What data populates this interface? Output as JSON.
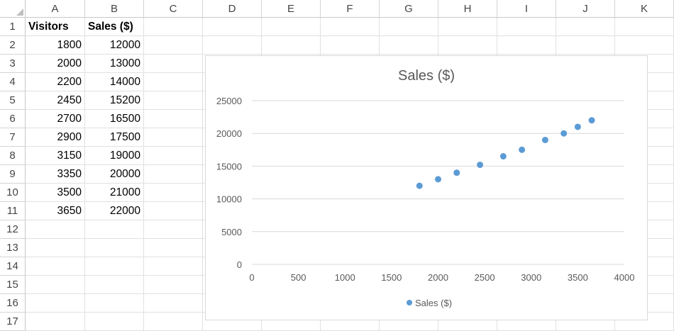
{
  "sheet": {
    "columns": [
      "A",
      "B",
      "C",
      "D",
      "E",
      "F",
      "G",
      "H",
      "I",
      "J",
      "K"
    ],
    "rows": [
      "1",
      "2",
      "3",
      "4",
      "5",
      "6",
      "7",
      "8",
      "9",
      "10",
      "11",
      "12",
      "13",
      "14",
      "15",
      "16",
      "17"
    ],
    "headers": [
      "Visitors",
      "Sales ($)"
    ],
    "data": [
      [
        "1800",
        "12000"
      ],
      [
        "2000",
        "13000"
      ],
      [
        "2200",
        "14000"
      ],
      [
        "2450",
        "15200"
      ],
      [
        "2700",
        "16500"
      ],
      [
        "2900",
        "17500"
      ],
      [
        "3150",
        "19000"
      ],
      [
        "3350",
        "20000"
      ],
      [
        "3500",
        "21000"
      ],
      [
        "3650",
        "22000"
      ]
    ]
  },
  "colors": {
    "marker": "#5b9bd5",
    "grid": "#d9d9d9",
    "text": "#595959"
  },
  "chart_data": {
    "type": "scatter",
    "title": "Sales ($)",
    "xlabel": "",
    "ylabel": "",
    "xlim": [
      0,
      4000
    ],
    "ylim": [
      0,
      25000
    ],
    "x_ticks": [
      "0",
      "500",
      "1000",
      "1500",
      "2000",
      "2500",
      "3000",
      "3500",
      "4000"
    ],
    "y_ticks": [
      "0",
      "5000",
      "10000",
      "15000",
      "20000",
      "25000"
    ],
    "grid": "horizontal",
    "legend": "bottom",
    "series": [
      {
        "name": "Sales ($)",
        "x": [
          1800,
          2000,
          2200,
          2450,
          2700,
          2900,
          3150,
          3350,
          3500,
          3650
        ],
        "y": [
          12000,
          13000,
          14000,
          15200,
          16500,
          17500,
          19000,
          20000,
          21000,
          22000
        ]
      }
    ]
  }
}
